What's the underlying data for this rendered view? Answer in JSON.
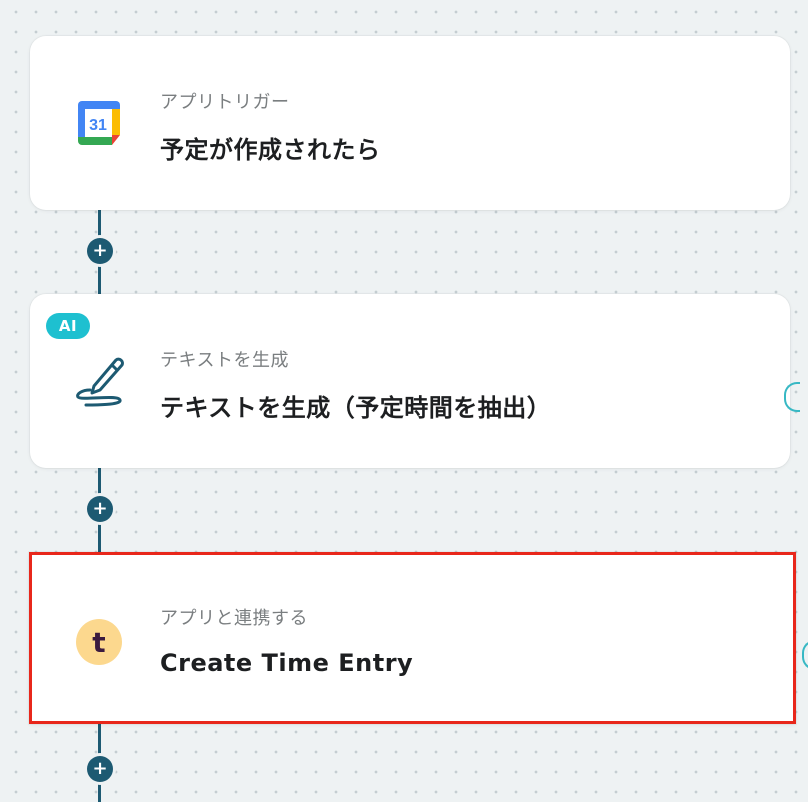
{
  "steps": [
    {
      "subtitle": "アプリトリガー",
      "title": "予定が作成されたら",
      "icon": "google-calendar-icon",
      "icon_text": "31"
    },
    {
      "subtitle": "テキストを生成",
      "title": "テキストを生成（予定時間を抽出）",
      "icon": "pen-icon",
      "badge": "AI"
    },
    {
      "subtitle": "アプリと連携する",
      "title": "Create Time Entry",
      "icon": "toggl-icon",
      "icon_text": "t"
    }
  ],
  "add_button_label": "+",
  "colors": {
    "connector": "#1d5a72",
    "selection_border": "#e8271b",
    "ai_badge": "#1ec0d0",
    "toggl_bg": "#fcd88e",
    "toggl_fg": "#3b1a3f"
  }
}
